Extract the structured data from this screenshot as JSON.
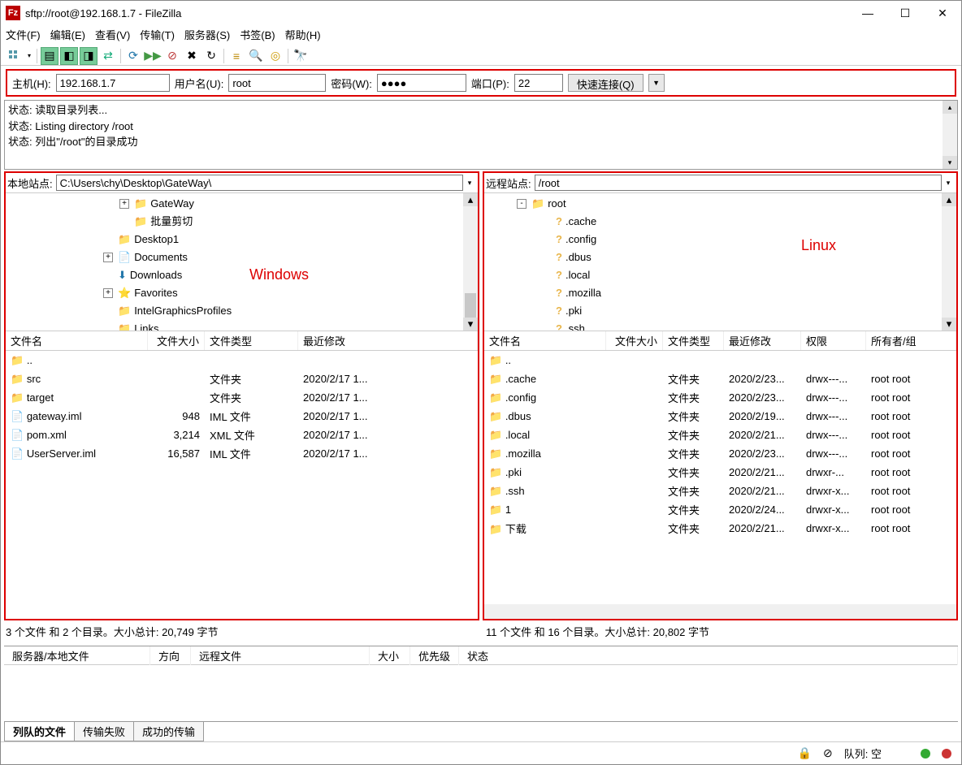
{
  "title": "sftp://root@192.168.1.7 - FileZilla",
  "menu": {
    "file": "文件(F)",
    "edit": "编辑(E)",
    "view": "查看(V)",
    "transfer": "传输(T)",
    "server": "服务器(S)",
    "bookmarks": "书签(B)",
    "help": "帮助(H)"
  },
  "quickconnect": {
    "host_label": "主机(H):",
    "host": "192.168.1.7",
    "user_label": "用户名(U):",
    "user": "root",
    "pass_label": "密码(W):",
    "pass": "●●●●",
    "port_label": "端口(P):",
    "port": "22",
    "btn": "快速连接(Q)"
  },
  "log": [
    {
      "prefix": "状态:",
      "msg": "读取目录列表..."
    },
    {
      "prefix": "状态:",
      "msg": "Listing directory /root"
    },
    {
      "prefix": "状态:",
      "msg": "列出\"/root\"的目录成功"
    }
  ],
  "local": {
    "label": "本地站点:",
    "path": "C:\\Users\\chy\\Desktop\\GateWay\\",
    "annotation": "Windows",
    "tree": [
      {
        "indent": 120,
        "exp": "+",
        "icon": "folder",
        "name": "GateWay"
      },
      {
        "indent": 120,
        "exp": "",
        "icon": "folder",
        "name": "批量剪切"
      },
      {
        "indent": 100,
        "exp": "",
        "icon": "folder",
        "name": "Desktop1"
      },
      {
        "indent": 100,
        "exp": "+",
        "icon": "doc",
        "name": "Documents"
      },
      {
        "indent": 100,
        "exp": "",
        "icon": "dl",
        "name": "Downloads"
      },
      {
        "indent": 100,
        "exp": "+",
        "icon": "fav",
        "name": "Favorites"
      },
      {
        "indent": 100,
        "exp": "",
        "icon": "folder",
        "name": "IntelGraphicsProfiles"
      },
      {
        "indent": 100,
        "exp": "",
        "icon": "folder",
        "name": "Links"
      }
    ],
    "cols": {
      "name": "文件名",
      "size": "文件大小",
      "type": "文件类型",
      "modified": "最近修改"
    },
    "files": [
      {
        "icon": "folder",
        "name": "..",
        "size": "",
        "type": "",
        "modified": ""
      },
      {
        "icon": "folder",
        "name": "src",
        "size": "",
        "type": "文件夹",
        "modified": "2020/2/17 1..."
      },
      {
        "icon": "folder",
        "name": "target",
        "size": "",
        "type": "文件夹",
        "modified": "2020/2/17 1..."
      },
      {
        "icon": "file",
        "name": "gateway.iml",
        "size": "948",
        "type": "IML 文件",
        "modified": "2020/2/17 1..."
      },
      {
        "icon": "xml",
        "name": "pom.xml",
        "size": "3,214",
        "type": "XML 文件",
        "modified": "2020/2/17 1..."
      },
      {
        "icon": "file",
        "name": "UserServer.iml",
        "size": "16,587",
        "type": "IML 文件",
        "modified": "2020/2/17 1..."
      }
    ],
    "status": "3 个文件 和 2 个目录。大小总计: 20,749 字节"
  },
  "remote": {
    "label": "远程站点:",
    "path": "/root",
    "annotation": "Linux",
    "tree": [
      {
        "indent": 20,
        "exp": "-",
        "icon": "folder",
        "name": "root"
      },
      {
        "indent": 50,
        "exp": "",
        "icon": "q",
        "name": ".cache"
      },
      {
        "indent": 50,
        "exp": "",
        "icon": "q",
        "name": ".config"
      },
      {
        "indent": 50,
        "exp": "",
        "icon": "q",
        "name": ".dbus"
      },
      {
        "indent": 50,
        "exp": "",
        "icon": "q",
        "name": ".local"
      },
      {
        "indent": 50,
        "exp": "",
        "icon": "q",
        "name": ".mozilla"
      },
      {
        "indent": 50,
        "exp": "",
        "icon": "q",
        "name": ".pki"
      },
      {
        "indent": 50,
        "exp": "",
        "icon": "q",
        "name": ".ssh"
      }
    ],
    "cols": {
      "name": "文件名",
      "size": "文件大小",
      "type": "文件类型",
      "modified": "最近修改",
      "perms": "权限",
      "owner": "所有者/组"
    },
    "files": [
      {
        "icon": "folder",
        "name": "..",
        "size": "",
        "type": "",
        "modified": "",
        "perms": "",
        "owner": ""
      },
      {
        "icon": "folder",
        "name": ".cache",
        "size": "",
        "type": "文件夹",
        "modified": "2020/2/23...",
        "perms": "drwx---...",
        "owner": "root root"
      },
      {
        "icon": "folder",
        "name": ".config",
        "size": "",
        "type": "文件夹",
        "modified": "2020/2/23...",
        "perms": "drwx---...",
        "owner": "root root"
      },
      {
        "icon": "folder",
        "name": ".dbus",
        "size": "",
        "type": "文件夹",
        "modified": "2020/2/19...",
        "perms": "drwx---...",
        "owner": "root root"
      },
      {
        "icon": "folder",
        "name": ".local",
        "size": "",
        "type": "文件夹",
        "modified": "2020/2/21...",
        "perms": "drwx---...",
        "owner": "root root"
      },
      {
        "icon": "folder",
        "name": ".mozilla",
        "size": "",
        "type": "文件夹",
        "modified": "2020/2/23...",
        "perms": "drwx---...",
        "owner": "root root"
      },
      {
        "icon": "folder",
        "name": ".pki",
        "size": "",
        "type": "文件夹",
        "modified": "2020/2/21...",
        "perms": "drwxr-...",
        "owner": "root root"
      },
      {
        "icon": "folder",
        "name": ".ssh",
        "size": "",
        "type": "文件夹",
        "modified": "2020/2/21...",
        "perms": "drwxr-x...",
        "owner": "root root"
      },
      {
        "icon": "folder",
        "name": "1",
        "size": "",
        "type": "文件夹",
        "modified": "2020/2/24...",
        "perms": "drwxr-x...",
        "owner": "root root"
      },
      {
        "icon": "folder",
        "name": "下载",
        "size": "",
        "type": "文件夹",
        "modified": "2020/2/21...",
        "perms": "drwxr-x...",
        "owner": "root root"
      }
    ],
    "status": "11 个文件 和 16 个目录。大小总计: 20,802 字节"
  },
  "transfer": {
    "cols": {
      "server": "服务器/本地文件",
      "dir": "方向",
      "remote": "远程文件",
      "size": "大小",
      "prio": "优先级",
      "status": "状态"
    }
  },
  "tabs": {
    "queued": "列队的文件",
    "failed": "传输失败",
    "success": "成功的传输"
  },
  "statusbar": {
    "queue_label": "队列: 空"
  }
}
